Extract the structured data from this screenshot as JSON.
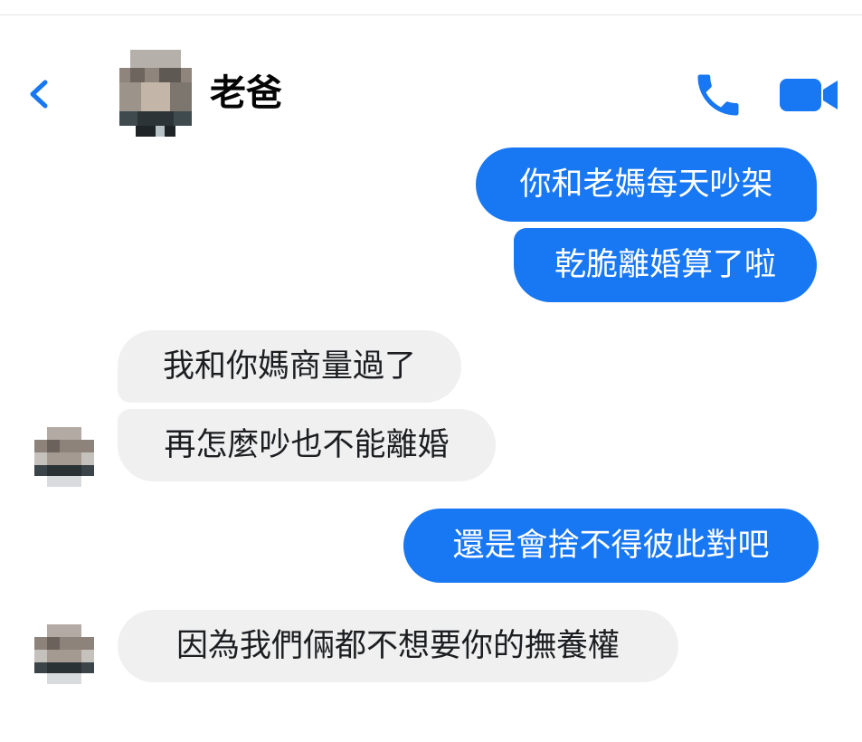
{
  "header": {
    "contact_name": "老爸",
    "back_icon": "chevron-left-icon",
    "call_icon": "phone-icon",
    "video_icon": "video-camera-icon"
  },
  "colors": {
    "accent": "#1877F2",
    "outgoing_bubble": "#1877F2",
    "incoming_bubble": "#F0F0F0",
    "incoming_text": "#1C1E21"
  },
  "messages": [
    {
      "direction": "outgoing",
      "text": "你和老媽每天吵架"
    },
    {
      "direction": "outgoing",
      "text": "乾脆離婚算了啦"
    },
    {
      "direction": "incoming",
      "text": "我和你媽商量過了"
    },
    {
      "direction": "incoming",
      "text": "再怎麼吵也不能離婚"
    },
    {
      "direction": "outgoing",
      "text": "還是會捨不得彼此對吧"
    },
    {
      "direction": "incoming",
      "text": "因為我們倆都不想要你的撫養權"
    }
  ]
}
